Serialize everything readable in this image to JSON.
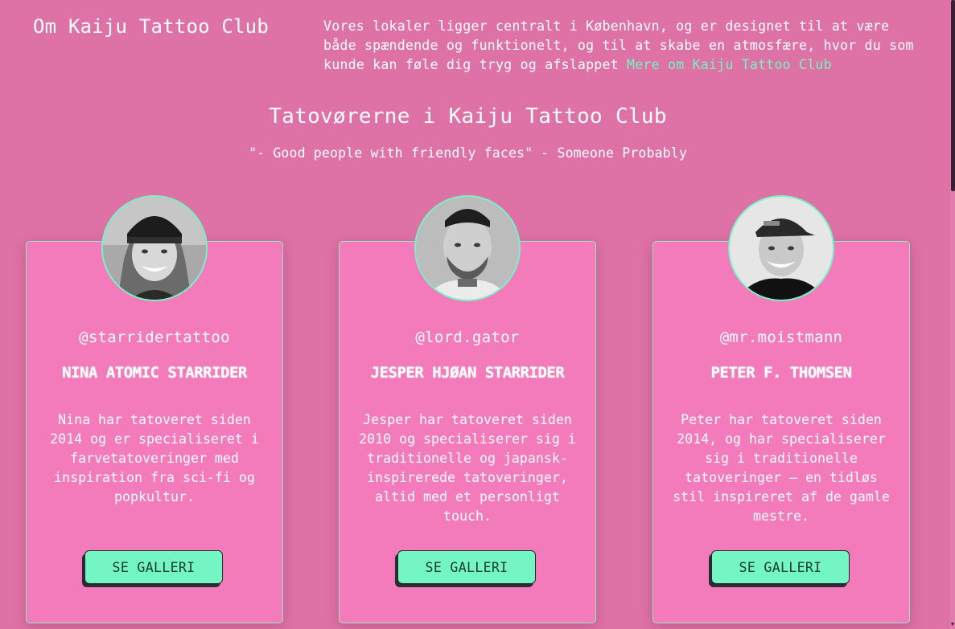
{
  "about": {
    "title": "Om Kaiju Tattoo Club",
    "text": "Vores lokaler ligger centralt i København, og er designet til at være både spændende og funktionelt, og til at skabe en atmosfære, hvor du som kunde kan føle dig tryg og afslappet ",
    "link_label": "Mere om Kaiju Tattoo Club"
  },
  "artists_section": {
    "title": "Tatovørerne i Kaiju Tattoo Club",
    "quote": "\"- Good people with friendly faces\" - Someone Probably"
  },
  "artists": [
    {
      "handle": "@starridertattoo",
      "name": "Nina Atomic Starrider",
      "bio": "Nina har tatoveret siden 2014 og er specialiseret i farvetatoveringer med inspiration fra sci-fi og popkultur.",
      "button_label": "SE GALLERI"
    },
    {
      "handle": "@lord.gator",
      "name": "Jesper Hjøan Starrider",
      "bio": "Jesper har tatoveret siden 2010 og specialiserer sig i traditionelle og japansk-inspirerede tatoveringer, altid med et personligt touch.",
      "button_label": "SE GALLERI"
    },
    {
      "handle": "@mr.moistmann",
      "name": "Peter F. Thomsen",
      "bio": "Peter har tatoveret siden 2014, og har specialiserer sig i traditionelle tatoveringer – en tidløs stil inspireret af de gamle mestre.",
      "button_label": "SE GALLERI"
    }
  ],
  "colors": {
    "background": "#de72a6",
    "card": "#f47bbb",
    "accent": "#74f5c4",
    "text": "#ffffff"
  }
}
